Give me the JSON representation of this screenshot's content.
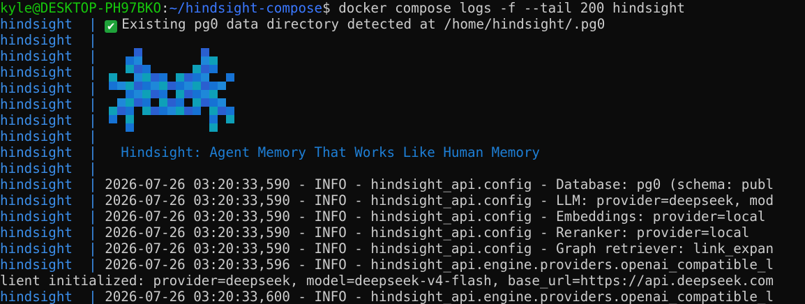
{
  "prompt": {
    "user_host": "kyle@DESKTOP-PH97BKO",
    "separator": ":",
    "path": "~/hindsight-compose",
    "dollar": "$",
    "command": " docker compose logs -f --tail 200 hindsight"
  },
  "service_prefix": "hindsight  | ",
  "lines": [
    {
      "type": "check",
      "text": "Existing pg0 data directory detected at /home/hindsight/.pg0"
    },
    {
      "type": "blank"
    },
    {
      "type": "blank"
    },
    {
      "type": "blank"
    },
    {
      "type": "blank"
    },
    {
      "type": "blank"
    },
    {
      "type": "blank"
    },
    {
      "type": "blank"
    },
    {
      "type": "banner",
      "text": "  Hindsight: Agent Memory That Works Like Human Memory"
    },
    {
      "type": "blank"
    },
    {
      "type": "log",
      "text": "2026-07-26 03:20:33,590 - INFO - hindsight_api.config - Database: pg0 (schema: publ"
    },
    {
      "type": "log",
      "text": "2026-07-26 03:20:33,590 - INFO - hindsight_api.config - LLM: provider=deepseek, mod"
    },
    {
      "type": "log",
      "text": "2026-07-26 03:20:33,590 - INFO - hindsight_api.config - Embeddings: provider=local"
    },
    {
      "type": "log",
      "text": "2026-07-26 03:20:33,590 - INFO - hindsight_api.config - Reranker: provider=local"
    },
    {
      "type": "log",
      "text": "2026-07-26 03:20:33,590 - INFO - hindsight_api.config - Graph retriever: link_expan"
    },
    {
      "type": "log",
      "text": "2026-07-26 03:20:33,596 - INFO - hindsight_api.engine.providers.openai_compatible_l"
    },
    {
      "type": "wrap",
      "text": "lient initialized: provider=deepseek, model=deepseek-v4-flash, base_url=https://api.deepseek.com"
    },
    {
      "type": "log",
      "text": "2026-07-26 03:20:33,600 - INFO - hindsight_api.engine.providers.openai_compatible_l"
    }
  ],
  "colors": {
    "background": "#0c0c0c",
    "foreground": "#cccccc",
    "service": "#3b8eea",
    "user_host": "#16c60c",
    "path": "#3b78ff",
    "check": "#1fa23a",
    "banner": "#1e7fd6",
    "logo_palette": [
      "#1672d4",
      "#1e88d9",
      "#0ea0b8",
      "#2a5fd0"
    ]
  },
  "icons": {
    "check": "white-check-mark-icon",
    "logo": "hindsight-pixel-logo"
  }
}
